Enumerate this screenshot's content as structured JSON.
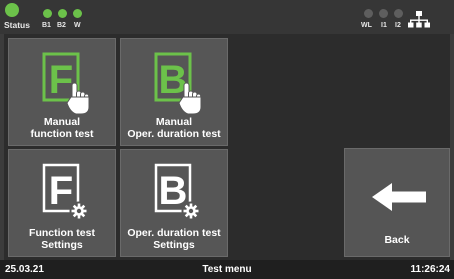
{
  "status_bar": {
    "status_label": "Status",
    "indicators": [
      {
        "label": "B1",
        "color": "#6cc24a"
      },
      {
        "label": "B2",
        "color": "#6cc24a"
      },
      {
        "label": "W",
        "color": "#6cc24a"
      }
    ],
    "right_indicators": [
      {
        "label": "WL",
        "color": "#5e5e5e"
      },
      {
        "label": "I1",
        "color": "#5e5e5e"
      },
      {
        "label": "I2",
        "color": "#5e5e5e"
      }
    ],
    "network_icon": "network-icon"
  },
  "tiles": [
    {
      "label_line1": "Manual",
      "label_line2": "function test",
      "letter": "F",
      "icon": "touch-hand-icon",
      "accent": "#6cc24a"
    },
    {
      "label_line1": "Manual",
      "label_line2": "Oper. duration test",
      "letter": "B",
      "icon": "touch-hand-icon",
      "accent": "#6cc24a"
    },
    {
      "label_line1": "Function test",
      "label_line2": "Settings",
      "letter": "F",
      "icon": "gear-icon",
      "accent": "#ffffff"
    },
    {
      "label_line1": "Oper. duration test",
      "label_line2": "Settings",
      "letter": "B",
      "icon": "gear-icon",
      "accent": "#ffffff"
    }
  ],
  "back": {
    "label": "Back",
    "icon": "arrow-left-icon"
  },
  "bottom_bar": {
    "date": "25.03.21",
    "title": "Test menu",
    "time": "11:26:24"
  }
}
